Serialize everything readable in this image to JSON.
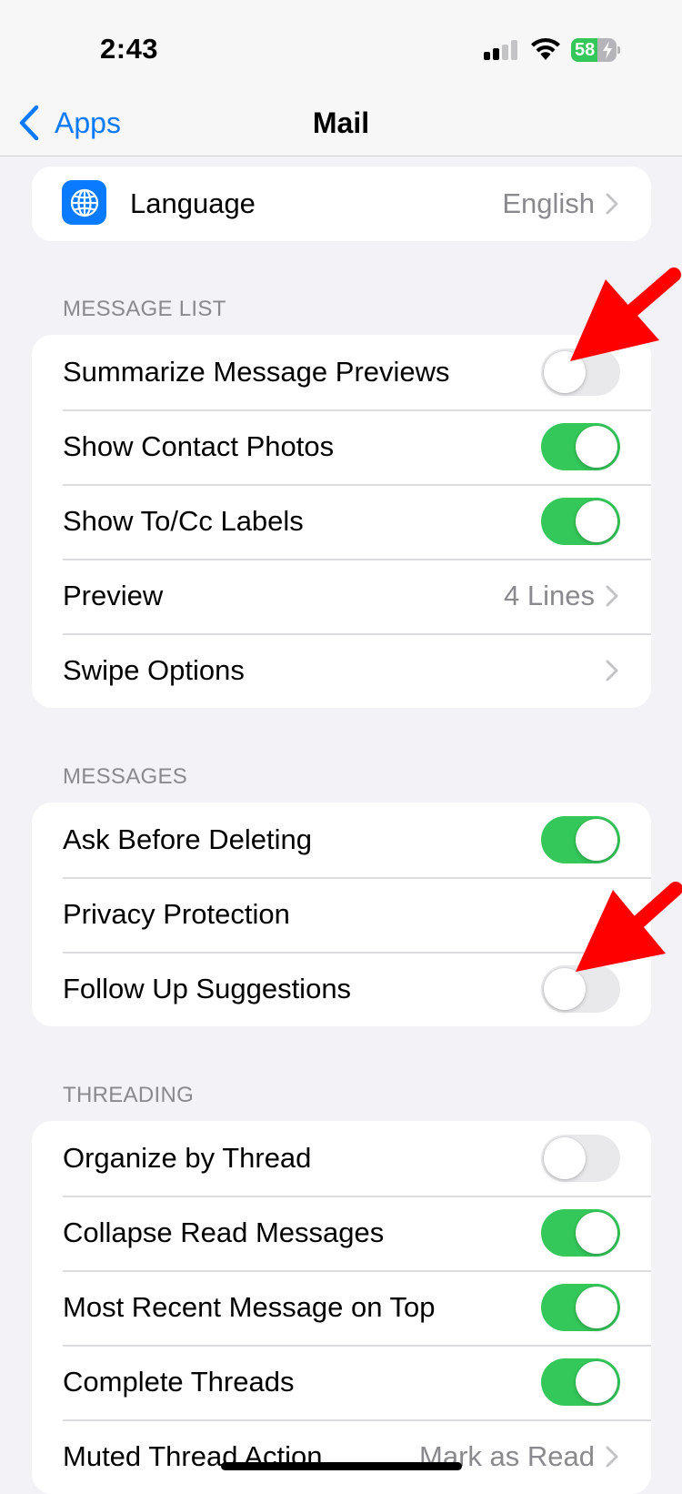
{
  "status_bar": {
    "time": "2:43",
    "battery_percent": "58",
    "battery_level": 0.58,
    "battery_charging": true,
    "signal_bars_active": 2,
    "signal_bars_total": 4,
    "icons": [
      "cellular-signal-icon",
      "wifi-icon",
      "battery-charging-icon"
    ]
  },
  "nav": {
    "back_label": "Apps",
    "title": "Mail"
  },
  "language": {
    "label": "Language",
    "value": "English",
    "icon": "globe-icon"
  },
  "sections": {
    "message_list": {
      "header": "MESSAGE LIST",
      "rows": [
        {
          "label": "Summarize Message Previews",
          "type": "toggle",
          "on": false
        },
        {
          "label": "Show Contact Photos",
          "type": "toggle",
          "on": true
        },
        {
          "label": "Show To/Cc Labels",
          "type": "toggle",
          "on": true
        },
        {
          "label": "Preview",
          "type": "link",
          "value": "4 Lines"
        },
        {
          "label": "Swipe Options",
          "type": "link",
          "value": ""
        }
      ]
    },
    "messages": {
      "header": "MESSAGES",
      "rows": [
        {
          "label": "Ask Before Deleting",
          "type": "toggle",
          "on": true
        },
        {
          "label": "Privacy Protection",
          "type": "link",
          "value": ""
        },
        {
          "label": "Follow Up Suggestions",
          "type": "toggle",
          "on": false
        }
      ]
    },
    "threading": {
      "header": "THREADING",
      "rows": [
        {
          "label": "Organize by Thread",
          "type": "toggle",
          "on": false
        },
        {
          "label": "Collapse Read Messages",
          "type": "toggle",
          "on": true
        },
        {
          "label": "Most Recent Message on Top",
          "type": "toggle",
          "on": true
        },
        {
          "label": "Complete Threads",
          "type": "toggle",
          "on": true
        },
        {
          "label": "Muted Thread Action",
          "type": "link",
          "value": "Mark as Read"
        }
      ]
    }
  },
  "annotations": [
    {
      "type": "red-arrow",
      "points_to": "Summarize Message Previews toggle"
    },
    {
      "type": "red-arrow",
      "points_to": "Follow Up Suggestions toggle"
    }
  ],
  "colors": {
    "accent": "#0A7AFF",
    "toggle_on": "#34C759",
    "toggle_off": "#E9E9EB",
    "background": "#F2F2F7",
    "secondary_text": "#8A8A8E",
    "annotation": "#FF0000"
  }
}
